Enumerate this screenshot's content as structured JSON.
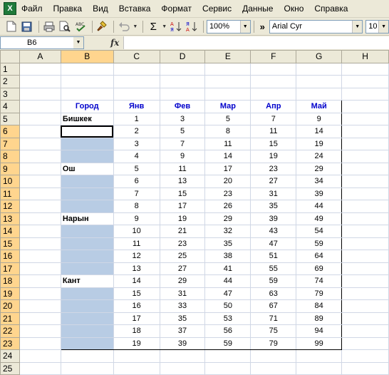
{
  "menu": [
    "Файл",
    "Правка",
    "Вид",
    "Вставка",
    "Формат",
    "Сервис",
    "Данные",
    "Окно",
    "Справка"
  ],
  "toolbar": {
    "zoom": "100%",
    "font_name": "Arial Cyr",
    "font_size": "10",
    "sigma": "Σ",
    "more_chevron": "»"
  },
  "formula": {
    "name_box": "B6",
    "fx_label": "fx",
    "content": ""
  },
  "columns": [
    "A",
    "B",
    "C",
    "D",
    "E",
    "F",
    "G",
    "H"
  ],
  "rows": [
    "1",
    "2",
    "3",
    "4",
    "5",
    "6",
    "7",
    "8",
    "9",
    "10",
    "11",
    "12",
    "13",
    "14",
    "15",
    "16",
    "17",
    "18",
    "19",
    "20",
    "21",
    "22",
    "23",
    "24",
    "25"
  ],
  "table": {
    "headers": [
      "Город",
      "Янв",
      "Фев",
      "Мар",
      "Апр",
      "Май"
    ],
    "body": [
      [
        "Бишкек",
        "1",
        "3",
        "5",
        "7",
        "9"
      ],
      [
        "",
        "2",
        "5",
        "8",
        "11",
        "14"
      ],
      [
        "",
        "3",
        "7",
        "11",
        "15",
        "19"
      ],
      [
        "",
        "4",
        "9",
        "14",
        "19",
        "24"
      ],
      [
        "Ош",
        "5",
        "11",
        "17",
        "23",
        "29"
      ],
      [
        "",
        "6",
        "13",
        "20",
        "27",
        "34"
      ],
      [
        "",
        "7",
        "15",
        "23",
        "31",
        "39"
      ],
      [
        "",
        "8",
        "17",
        "26",
        "35",
        "44"
      ],
      [
        "Нарын",
        "9",
        "19",
        "29",
        "39",
        "49"
      ],
      [
        "",
        "10",
        "21",
        "32",
        "43",
        "54"
      ],
      [
        "",
        "11",
        "23",
        "35",
        "47",
        "59"
      ],
      [
        "",
        "12",
        "25",
        "38",
        "51",
        "64"
      ],
      [
        "",
        "13",
        "27",
        "41",
        "55",
        "69"
      ],
      [
        "Кант",
        "14",
        "29",
        "44",
        "59",
        "74"
      ],
      [
        "",
        "15",
        "31",
        "47",
        "63",
        "79"
      ],
      [
        "",
        "16",
        "33",
        "50",
        "67",
        "84"
      ],
      [
        "",
        "17",
        "35",
        "53",
        "71",
        "89"
      ],
      [
        "",
        "18",
        "37",
        "56",
        "75",
        "94"
      ],
      [
        "",
        "19",
        "39",
        "59",
        "79",
        "99"
      ]
    ]
  },
  "colors": {
    "header_text": "#0000cc",
    "selection_fill": "#b8cce4",
    "chrome": "#ece9d8"
  }
}
